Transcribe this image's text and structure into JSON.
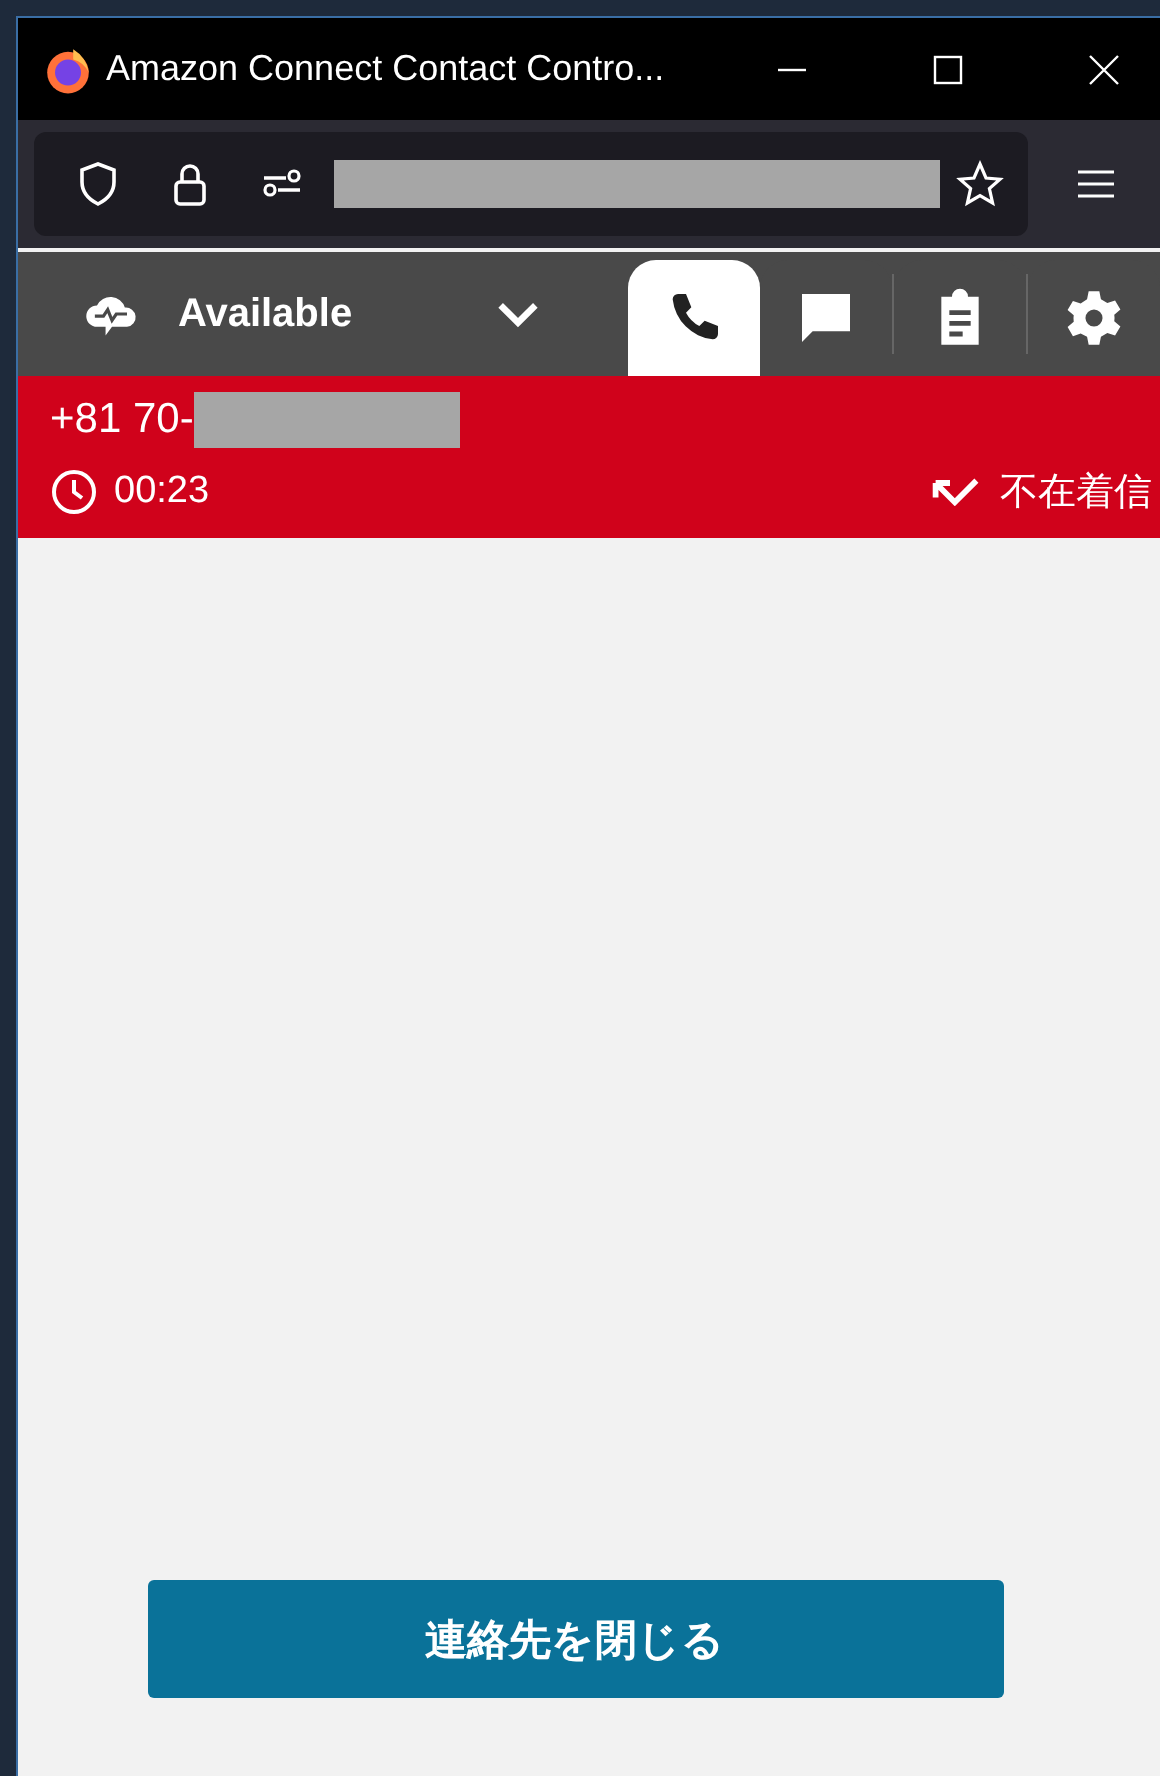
{
  "window": {
    "title": "Amazon Connect Contact Contro..."
  },
  "address_bar": {
    "redacted": true
  },
  "agent_status": {
    "label": "Available"
  },
  "tabs": [
    {
      "kind": "phone",
      "selected": true
    },
    {
      "kind": "chat",
      "selected": false
    },
    {
      "kind": "tasks",
      "selected": false
    },
    {
      "kind": "settings",
      "selected": false
    }
  ],
  "contact": {
    "number": "+81 70-",
    "number_redacted": true,
    "timer": "00:23",
    "status": "不在着信"
  },
  "buttons": [
    {
      "label": "連絡先を閉じる"
    }
  ]
}
